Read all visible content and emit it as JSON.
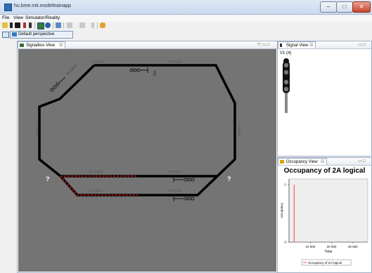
{
  "window": {
    "title": "hu.bme.mit.modeltrainapp",
    "min": "–",
    "max": "□",
    "close": "✕"
  },
  "menu": [
    "File",
    "View",
    "Simulator/Reality"
  ],
  "perspective": {
    "label": "Default perspective"
  },
  "signalbox": {
    "tab_label": "Signalbox View",
    "tab_close": "☒",
    "tab_controls": "▽ ▭ □",
    "track_labels": {
      "top_left": "2A logical",
      "top_right": "1B logical",
      "left": "3A logical",
      "right": "1A logical",
      "mid_left": "5A logical",
      "mid_right": "5B logical",
      "bottom_left": "4A logical",
      "bottom_right": "4B logical",
      "diag_top_left": "6A logical",
      "turnout_top": "102"
    },
    "unknown_markers": [
      "?",
      "?"
    ],
    "colors": {
      "track": "#000000",
      "occupied": "#c81414",
      "background": "#747474"
    }
  },
  "signal_view": {
    "tab_label": "Signal View",
    "tab_close": "☒",
    "tab_controls": "▭ □",
    "signal_label": "V1 (4)",
    "lamps": 4
  },
  "occupancy_view": {
    "tab_label": "Occupancy View",
    "tab_close": "☒",
    "tab_controls": "▭ □"
  },
  "chart_data": {
    "type": "line",
    "title": "Occupancy of 2A logical",
    "xlabel": "Time",
    "ylabel": "occupancy",
    "x_ticks": [
      "10 000",
      "20 000",
      "30 000"
    ],
    "y_ticks": [
      "0",
      "1"
    ],
    "xlim": [
      0,
      37000
    ],
    "ylim": [
      0,
      1.1
    ],
    "series": [
      {
        "name": "Occupancy of 2A logical",
        "color": "#ff4040",
        "points": [
          [
            2400,
            0
          ],
          [
            2400,
            1
          ]
        ]
      }
    ],
    "legend": "bottom"
  }
}
